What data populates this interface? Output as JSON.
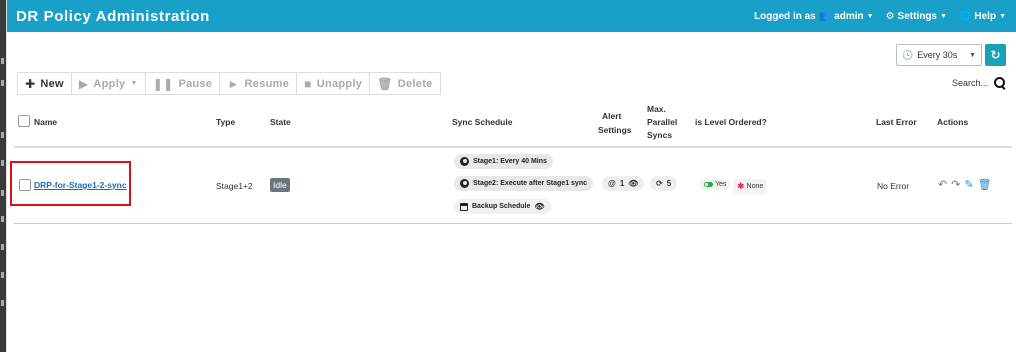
{
  "header": {
    "title": "DR Policy Administration",
    "logged_in_label": "Logged in as",
    "user": "admin",
    "settings_label": "Settings",
    "help_label": "Help"
  },
  "refresh": {
    "interval": "Every 30s"
  },
  "toolbar": {
    "new_label": "New",
    "apply_label": "Apply",
    "pause_label": "Pause",
    "resume_label": "Resume",
    "unapply_label": "Unapply",
    "delete_label": "Delete"
  },
  "search": {
    "label": "Search..."
  },
  "table": {
    "columns": {
      "name": "Name",
      "type": "Type",
      "state": "State",
      "sync_schedule": "Sync Schedule",
      "alert_settings_1": "Alert",
      "alert_settings_2": "Settings",
      "max_syncs_1": "Max.",
      "max_syncs_2": "Parallel",
      "max_syncs_3": "Syncs",
      "level_ordered": "is Level Ordered?",
      "last_error": "Last Error",
      "actions": "Actions"
    },
    "rows": [
      {
        "name": "DRP-for-Stage1-2-sync",
        "type": "Stage1+2",
        "state": "Idle",
        "schedule_stage1": "Stage1: Every 40 Mins",
        "schedule_stage2": "Stage2: Execute after Stage1 sync",
        "backup_schedule": "Backup Schedule",
        "alert_count": "1",
        "max_parallel": "5",
        "level_ordered_yes": "Yes",
        "level_ordered_none": "None",
        "last_error": "No Error"
      }
    ]
  },
  "colors": {
    "header_bg": "#18a0c9",
    "highlight_border": "#dd1111",
    "link": "#1a6fb3"
  }
}
